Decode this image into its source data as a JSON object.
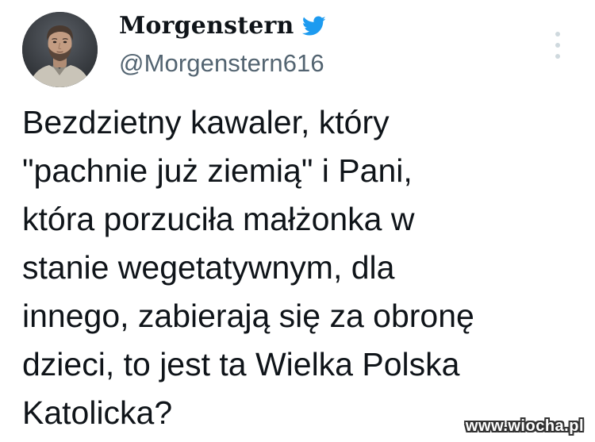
{
  "tweet": {
    "display_name": "Morgenstern",
    "handle": "@Morgenstern616",
    "text_lines": [
      "Bezdzietny kawaler, który",
      "\"pachnie już ziemią\" i Pani,",
      "która porzuciła małżonka w",
      "stanie wegetatywnym, dla",
      "innego, zabierają się za obronę",
      "dzieci,  to jest ta Wielka Polska",
      "Katolicka?"
    ]
  },
  "icons": {
    "verified_bird": "twitter-bird-icon",
    "more": "more-options-icon"
  },
  "colors": {
    "twitter_blue": "#1d9bf0",
    "text_primary": "#0f1419",
    "text_secondary": "#536471",
    "more_icon": "#cfd9de"
  },
  "watermark": "www.wiocha.pl"
}
